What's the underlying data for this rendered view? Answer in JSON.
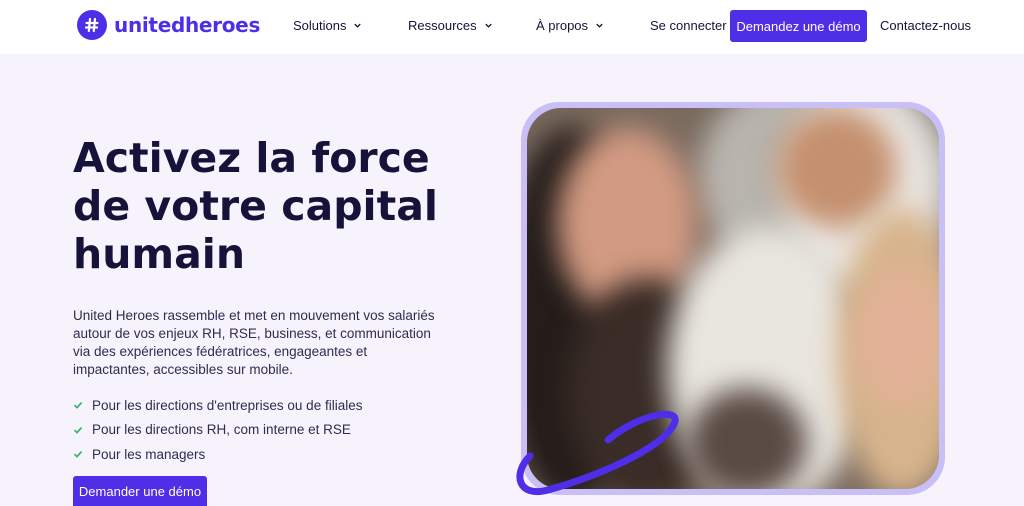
{
  "brand": {
    "name": "unitedheroes",
    "color": "#4f2ee8"
  },
  "nav": {
    "items": [
      {
        "label": "Solutions"
      },
      {
        "label": "Ressources"
      },
      {
        "label": "À propos"
      }
    ],
    "login": "Se connecter",
    "demo_button": "Demandez une démo",
    "contact": "Contactez-nous"
  },
  "hero": {
    "title_lines": [
      "Activez la force",
      "de votre capital",
      "humain"
    ],
    "description": "United Heroes rassemble et met en mouvement vos salariés autour de vos enjeux RH, RSE, business, et communication via des expériences fédératrices, engageantes et impactantes, accessibles sur mobile.",
    "bullets": [
      "Pour les directions d'entreprises ou de filiales",
      "Pour les directions RH, com interne et RSE",
      "Pour les managers"
    ],
    "cta": "Demander une démo"
  },
  "icons": {
    "chevron": "chevron-down-icon",
    "check": "check-icon",
    "logo": "hashtag-logo-icon"
  },
  "colors": {
    "accent": "#4f2ee8",
    "check": "#2fb36a",
    "heading": "#16133a",
    "background": "#f6f3fd"
  }
}
